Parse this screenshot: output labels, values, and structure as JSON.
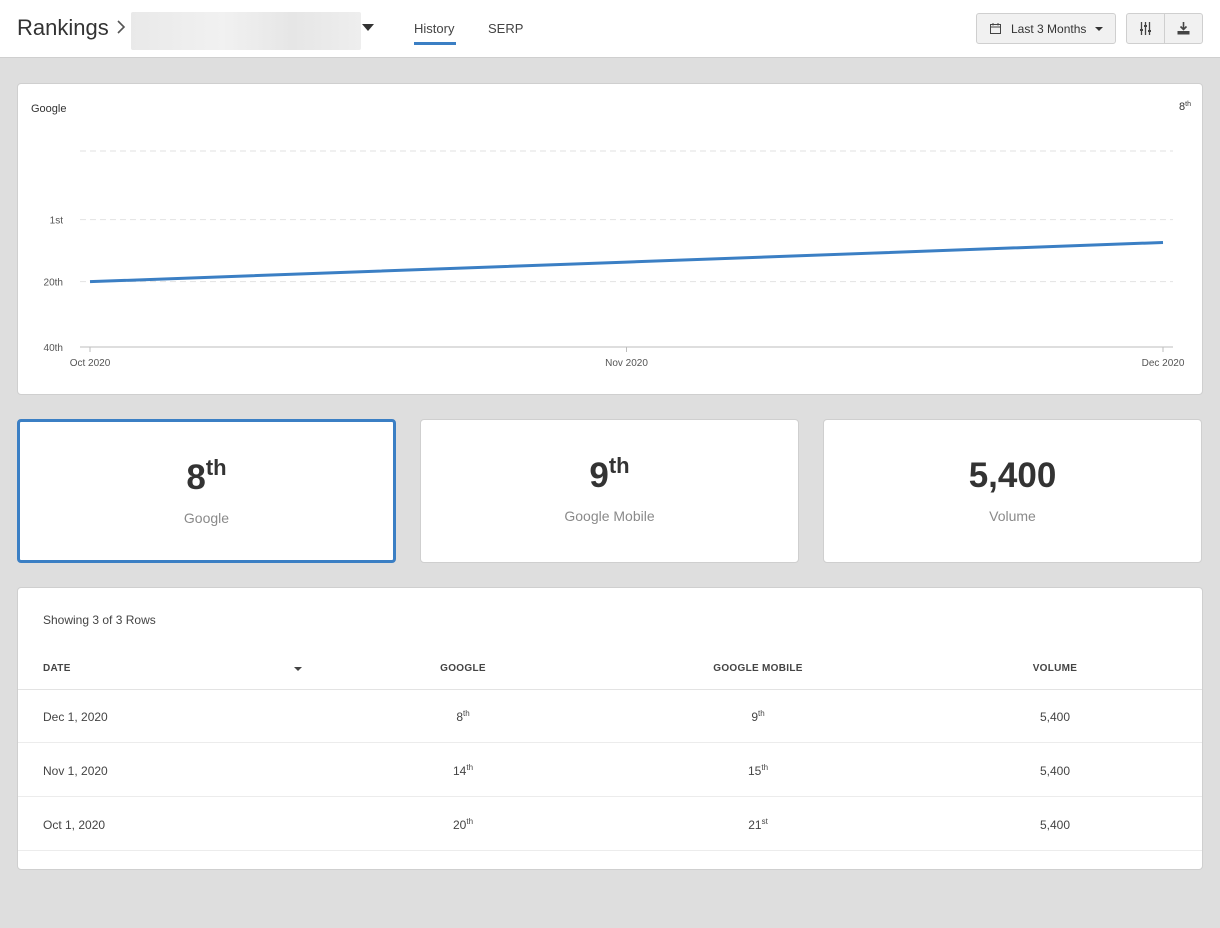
{
  "header": {
    "title": "Rankings",
    "tabs": [
      {
        "label": "History"
      },
      {
        "label": "SERP"
      }
    ],
    "date_range": "Last 3 Months"
  },
  "chart": {
    "series_name": "Google",
    "current_rank_num": "8",
    "current_rank_suffix": "th",
    "accent_color": "#3b7fc4"
  },
  "chart_data": {
    "type": "line",
    "x": [
      "Oct 2020",
      "Nov 2020",
      "Dec 2020"
    ],
    "series": [
      {
        "name": "Google",
        "values": [
          20,
          14,
          8
        ]
      }
    ],
    "y_tick_labels": [
      "1st",
      "20th",
      "40th"
    ],
    "y_ticks": [
      1,
      20,
      40
    ],
    "ylim": [
      40,
      -20
    ],
    "y_inverted": true,
    "grid": true,
    "legend": "top-right"
  },
  "stats": [
    {
      "num": "8",
      "suffix": "th",
      "label": "Google"
    },
    {
      "num": "9",
      "suffix": "th",
      "label": "Google Mobile"
    },
    {
      "num": "5,400",
      "suffix": "",
      "label": "Volume"
    }
  ],
  "table": {
    "showing": "Showing 3 of 3 Rows",
    "headers": [
      "DATE",
      "GOOGLE",
      "GOOGLE MOBILE",
      "VOLUME"
    ],
    "rows": [
      {
        "date": "Dec 1, 2020",
        "google": "8",
        "google_sfx": "th",
        "mobile": "9",
        "mobile_sfx": "th",
        "volume": "5,400"
      },
      {
        "date": "Nov 1, 2020",
        "google": "14",
        "google_sfx": "th",
        "mobile": "15",
        "mobile_sfx": "th",
        "volume": "5,400"
      },
      {
        "date": "Oct 1, 2020",
        "google": "20",
        "google_sfx": "th",
        "mobile": "21",
        "mobile_sfx": "st",
        "volume": "5,400"
      }
    ]
  }
}
